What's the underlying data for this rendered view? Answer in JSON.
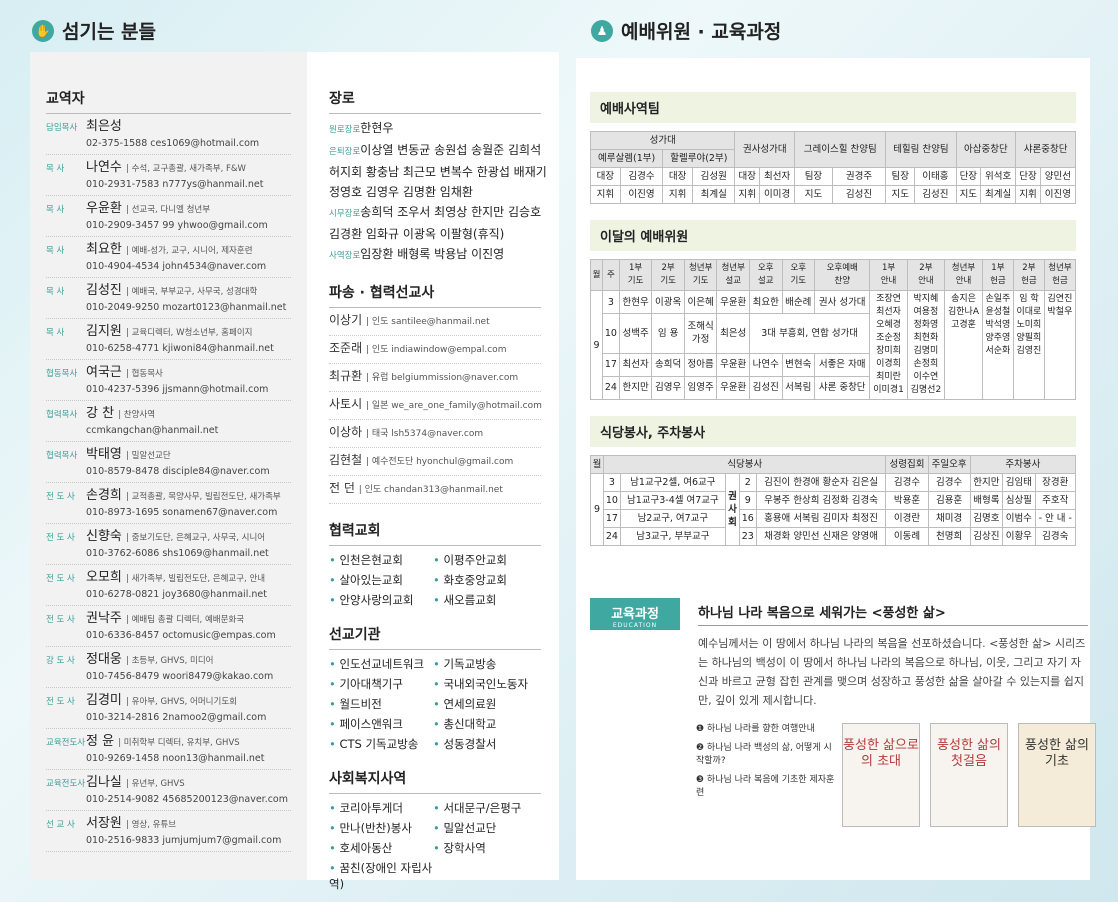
{
  "left": {
    "title": "섬기는 분들",
    "icon_glyph": "✋",
    "section": "교역자",
    "ministers": [
      {
        "role": "담임목사",
        "name": "최은성",
        "desc": "",
        "contact": "02-375-1588  ces1069@hotmail.com"
      },
      {
        "role": "목    사",
        "name": "나연수",
        "desc": "| 수석, 교구총괄, 새가족부, F&W",
        "contact": "010-2931-7583  n777ys@hanmail.net"
      },
      {
        "role": "목    사",
        "name": "우윤환",
        "desc": "| 선교국, 다니엘 청년부",
        "contact": "010-2909-3457 99  yhwoo@gmail.com"
      },
      {
        "role": "목    사",
        "name": "최요한",
        "desc": "| 예배-성가, 교구, 시니어, 제자훈련",
        "contact": "010-4904-4534  john4534@naver.com"
      },
      {
        "role": "목    사",
        "name": "김성진",
        "desc": "| 예배국, 부부교구, 사무국, 성경대학",
        "contact": "010-2049-9250  mozart0123@hanmail.net"
      },
      {
        "role": "목    사",
        "name": "김지원",
        "desc": "| 교육디렉터, W청소년부, 홈페이지",
        "contact": "010-6258-4771  kjiwoni84@hanmail.net"
      },
      {
        "role": "협동목사",
        "name": "여국근",
        "desc": "| 협동목사",
        "contact": "010-4237-5396  jjsmann@hotmail.com"
      },
      {
        "role": "협력목사",
        "name": "강  찬",
        "desc": "| 찬양사역",
        "contact": "ccmkangchan@hanmail.net"
      },
      {
        "role": "협력목사",
        "name": "박태영",
        "desc": "| 밀알선교단",
        "contact": "010-8579-8478  disciple84@naver.com"
      },
      {
        "role": "전 도 사",
        "name": "손경희",
        "desc": "| 교적총괄, 목양사무, 빌립전도단, 새가족부",
        "contact": "010-8973-1695  sonamen67@naver.com"
      },
      {
        "role": "전 도 사",
        "name": "신향숙",
        "desc": "| 중보기도단, 은혜교구, 사무국, 시니어",
        "contact": "010-3762-6086  shs1069@hanmail.net"
      },
      {
        "role": "전 도 사",
        "name": "오모희",
        "desc": "| 새가족부, 빌립전도단, 은혜교구, 안내",
        "contact": "010-6278-0821  joy3680@hanmail.net"
      },
      {
        "role": "전 도 사",
        "name": "권낙주",
        "desc": "| 예배팀 총괄 디렉터, 예배문화국",
        "contact": "010-6336-8457  octomusic@empas.com"
      },
      {
        "role": "강 도 사",
        "name": "정대웅",
        "desc": "| 초등부, GHVS, 미디어",
        "contact": "010-7456-8479  woori8479@kakao.com"
      },
      {
        "role": "전 도 사",
        "name": "김경미",
        "desc": "| 유아부, GHVS, 어머니기도회",
        "contact": "010-3214-2816  2namoo2@gmail.com"
      },
      {
        "role": "교육전도사",
        "name": "정  윤",
        "desc": "| 미취학부 디렉터, 유치부, GHVS",
        "contact": "010-9269-1458  noon13@hanmail.net"
      },
      {
        "role": "교육전도사",
        "name": "김나실",
        "desc": "| 유년부, GHVS",
        "contact": "010-2514-9082  45685200123@naver.com"
      },
      {
        "role": "선 교 사",
        "name": "서장원",
        "desc": "| 영상, 유튜브",
        "contact": "010-2516-9833  jumjumjum7@gmail.com"
      }
    ]
  },
  "mid": {
    "elder_title": "장로",
    "elders": [
      {
        "role": "원로장로",
        "names": "한현우"
      },
      {
        "role": "은퇴장로",
        "names": "이상열 변동균 송원섭 송월준 김희석"
      },
      {
        "role": "",
        "names": "허지회 황충남 최근모 변복수 한광섭 배재기"
      },
      {
        "role": "",
        "names": "정영호 김영우 김명환 임채환"
      },
      {
        "role": "시무장로",
        "names": "송희덕 조우서 최영상 한지만 김승호"
      },
      {
        "role": "",
        "names": "김경환 임화규 이광옥 이팔형(휴직)"
      },
      {
        "role": "사역장로",
        "names": "임장환 배형록 박용남 이진영"
      }
    ],
    "mission_title": "파송 · 협력선교사",
    "missionaries": [
      {
        "name": "이상기",
        "region": "| 인도",
        "email": "santilee@hanmail.net"
      },
      {
        "name": "조준래",
        "region": "| 인도",
        "email": "indiawindow@empal.com"
      },
      {
        "name": "최규환",
        "region": "| 유럽",
        "email": "belgiummission@naver.com"
      },
      {
        "name": "사토시",
        "region": "| 일본",
        "email": "we_are_one_family@hotmail.com"
      },
      {
        "name": "이상하",
        "region": "| 태국",
        "email": "lsh5374@naver.com"
      },
      {
        "name": "김현철",
        "region": "| 예수전도단",
        "email": "hyonchul@gmail.com"
      },
      {
        "name": "전  던",
        "region": "| 인도",
        "email": "chandan313@hanmail.net"
      }
    ],
    "churches_title": "협력교회",
    "churches": [
      "인천은현교회",
      "이평주안교회",
      "살아있는교회",
      "화호중앙교회",
      "안양사랑의교회",
      "새오름교회"
    ],
    "agencies_title": "선교기관",
    "agencies": [
      "인도선교네트워크",
      "기독교방송",
      "기아대책기구",
      "국내외국인노동자",
      "월드비전",
      "연세의료원",
      "페이스앤워크",
      "총신대학교",
      "CTS 기독교방송",
      "성동경찰서"
    ],
    "welfare_title": "사회복지사역",
    "welfare": [
      "코리아투게더",
      "서대문구/은평구",
      "만나(반찬)봉사",
      "밀알선교단",
      "호세아동산",
      "장학사역",
      "꿈친(장애인 자립사역)"
    ]
  },
  "right": {
    "title": "예배위원 · 교육과정",
    "icon_glyph": "♟",
    "service": {
      "title": "예배사역팀",
      "groups": [
        "성가대",
        "권사성가대",
        "그레이스힐 찬양팀",
        "테힐림 찬양팀",
        "아삽중창단",
        "샤론중창단"
      ],
      "subgroups": [
        "예루살렘(1부)",
        "할렐루야(2부)"
      ],
      "rows": [
        [
          "대장",
          "김경수",
          "대장",
          "김성원",
          "대장",
          "최선자",
          "팀장",
          "권경주",
          "팀장",
          "이태홍",
          "단장",
          "위석호",
          "단장",
          "양민선"
        ],
        [
          "지휘",
          "이진영",
          "지휘",
          "최계실",
          "지휘",
          "이미경",
          "지도",
          "김성진",
          "지도",
          "김성진",
          "지도",
          "최계실",
          "지휘",
          "이진영"
        ]
      ]
    },
    "monthly": {
      "title": "이달의 예배위원",
      "headers": [
        "월",
        "주",
        "1부\n기도",
        "2부\n기도",
        "청년부\n기도",
        "청년부\n설교",
        "오후\n설교",
        "오후\n기도",
        "오후예배\n찬양",
        "1부\n안내",
        "2부\n안내",
        "청년부\n안내",
        "1부\n헌금",
        "2부\n헌금",
        "청년부\n헌금"
      ],
      "month": "9",
      "weeks": [
        [
          "3",
          "한현우",
          "이광옥",
          "이은혜",
          "우윤환",
          "최요한",
          "배순례",
          "권사 성가대"
        ],
        [
          "10",
          "성백주",
          "임 용",
          "조해식\n가정",
          "최은성",
          "3대 부흥회, 연합 성가대"
        ],
        [
          "17",
          "최선자",
          "송희덕",
          "정아름",
          "우윤환",
          "나연수",
          "변현숙",
          "서좋은 자매"
        ],
        [
          "24",
          "한지만",
          "김영우",
          "임영주",
          "우윤환",
          "김성진",
          "서복림",
          "샤론 중창단"
        ]
      ],
      "guides": [
        "조장연\n최선자\n오혜경\n조순정\n장미희\n이경희\n최미란\n이미경1",
        "박지혜\n여용정\n정화영\n최현화\n김명미\n손정희\n이수연\n김명선2",
        "송지은\n김한나A\n고경훈",
        "손일주\n윤성철\n박석영\n양주영\n서순화",
        "임  학\n이대로\n노미희\n양필희\n김영진",
        "김연진\n박철우"
      ]
    },
    "kitchen": {
      "title": "식당봉사, 주차봉사",
      "h_month": "월",
      "h_kitchen": "식당봉사",
      "h_choir": "성령집회",
      "h_sun": "주일오후",
      "h_parking": "주차봉사",
      "month": "9",
      "gwon": "권사회",
      "rows": [
        [
          "3",
          "남1교구2셀, 여6교구",
          "2",
          "김진이 한경애 황순자 김은실"
        ],
        [
          "10",
          "남1교구3-4셀 여7교구",
          "9",
          "우봉주 한상희 김정화 김경숙"
        ],
        [
          "17",
          "남2교구, 여7교구",
          "16",
          "홍용애 서복림 김미자 최정진"
        ],
        [
          "24",
          "남3교구, 부부교구",
          "23",
          "채경화 양민선 신재은 양영애"
        ]
      ],
      "extra": [
        [
          "김경수",
          "박용훈",
          "이경란",
          "이동례",
          "이미영"
        ],
        [
          "김경수",
          "김용훈",
          "채미경",
          "천명희",
          "최선자"
        ],
        [
          "한지만",
          "배형록",
          "김명호",
          "김상진",
          "김익삼"
        ],
        [
          "김임태",
          "심상필",
          "이범수",
          "이황우",
          "임  용"
        ],
        [
          "장경환",
          "주호작",
          "- 안 내 -",
          "김경숙",
          "한경애"
        ]
      ]
    },
    "edu": {
      "badge": "교육과정",
      "badge_en": "EDUCATION",
      "headline": "하나님 나라 복음으로 세워가는 <풍성한 삶>",
      "para": "예수님께서는 이 땅에서 하나님 나라의 복음을 선포하셨습니다. <풍성한 삶> 시리즈는 하나님의 백성이 이 땅에서 하나님 나라의 복음으로 하나님, 이웃, 그리고 자기 자신과 바르고 균형 잡힌 관계를 맺으며 성장하고 풍성한 삶을 살아갈 수 있는지를 쉽지만, 깊이 있게 제시합니다.",
      "steps": [
        "❶ 하나님 나라를 향한 여행안내",
        "❷ 하나님 나라 백성의 삶, 어떻게 시작할까?",
        "❸ 하나님 나라 복음에 기초한 제자훈련"
      ],
      "books": [
        "풍성한 삶으로의 초대",
        "풍성한 삶의 첫걸음",
        "풍성한 삶의 기초"
      ]
    }
  }
}
